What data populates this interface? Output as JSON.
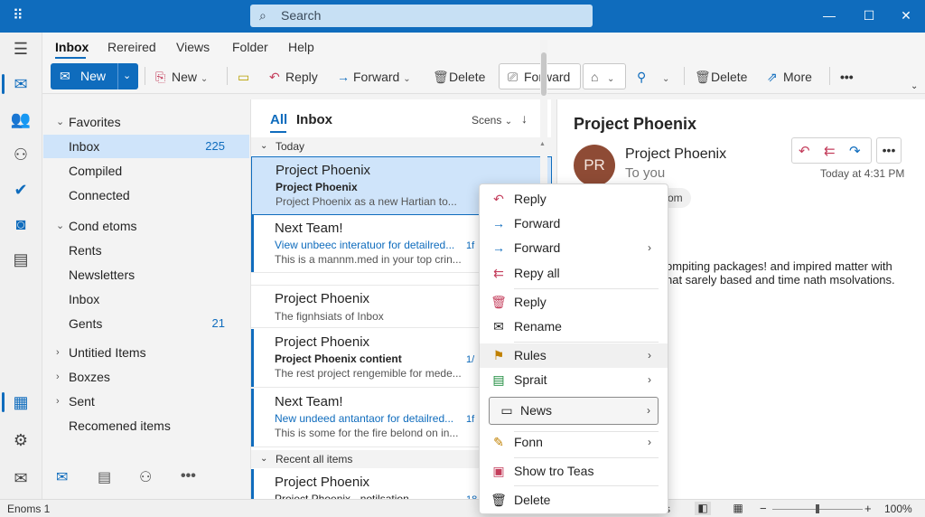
{
  "titlebar": {
    "search_placeholder": "Search",
    "minimize_glyph": "—",
    "maximize_glyph": "☐",
    "close_glyph": "✕"
  },
  "menubar": {
    "items": [
      "Inbox",
      "Rereired",
      "Views",
      "Folder",
      "Help"
    ]
  },
  "toolbar": {
    "new_primary": "New",
    "new_secondary": "New",
    "reply": "Reply",
    "forward": "Forward",
    "delete": "Delete",
    "forward_box": "Forward",
    "delete2": "Delete",
    "more": "More",
    "overflow": "•••"
  },
  "folders": {
    "favorites_label": "Favorites",
    "favorites": [
      {
        "label": "Inbox",
        "count": "225"
      },
      {
        "label": "Compiled",
        "count": ""
      },
      {
        "label": "Connected",
        "count": ""
      }
    ],
    "group_label": "Cond etoms",
    "group_items": [
      {
        "label": "Rents",
        "count": ""
      },
      {
        "label": "Newsletters",
        "count": ""
      },
      {
        "label": "Inbox",
        "count": ""
      },
      {
        "label": "Gents",
        "count": "21"
      }
    ],
    "collapsed": [
      "Untitied Items",
      "Boxzes",
      "Sent"
    ],
    "recommended": "Recomened items"
  },
  "list": {
    "tab_all": "All",
    "tab_inbox": "Inbox",
    "sort_label": "Scens",
    "section_today": "Today",
    "section_recent": "Recent all items",
    "messages": [
      {
        "from": "Project Phoenix",
        "subject": "Project Phoenix",
        "preview": "Project Phoenix as a new Hartian to...",
        "date": ""
      },
      {
        "from": "Next Team!",
        "subject": "View unbeec interatuor for detailred...",
        "preview": "This is a mannm.med in your top crin...",
        "date": "1f"
      },
      {
        "from": "Project Phoenix",
        "subject": "The fignhsiats of Inbox",
        "preview": "",
        "date": ""
      },
      {
        "from": "Project Phoenix",
        "subject": "Project Phoenix contient",
        "preview": "The rest project rengemible for mede...",
        "date": "1/"
      },
      {
        "from": "Next Team!",
        "subject": "New undeed antantaor for detailred...",
        "preview": "This is some for the fire belond on in...",
        "date": "1f"
      },
      {
        "from": "Project Phoenix",
        "subject": "Project Phoenix · notilsation",
        "preview": "",
        "date": "18"
      }
    ]
  },
  "reading": {
    "title": "Project Phoenix",
    "avatar_initials": "PR",
    "sender": "Project Phoenix",
    "to": "To you",
    "time": "Today at 4:31 PM",
    "chip": "om",
    "body_line1": "ompiting packages! and impired matter with",
    "body_line2": "nat sarely based and time nath msolvations."
  },
  "context_menu": {
    "items": [
      {
        "label": "Reply",
        "icon": "reply-icon",
        "submenu": false
      },
      {
        "label": "Forward",
        "icon": "forward-icon",
        "submenu": false
      },
      {
        "label": "Forward",
        "icon": "forward-icon",
        "submenu": true
      },
      {
        "label": "Repy all",
        "icon": "reply-all-icon",
        "submenu": false
      },
      {
        "label": "Reply",
        "icon": "trash-icon",
        "submenu": false
      },
      {
        "label": "Rename",
        "icon": "mail-icon",
        "submenu": false
      },
      {
        "label": "Rules",
        "icon": "rules-icon",
        "submenu": true
      },
      {
        "label": "Sprait",
        "icon": "comment-icon",
        "submenu": true
      },
      {
        "label": "News",
        "icon": "folder-icon",
        "submenu": true
      },
      {
        "label": "Fonn",
        "icon": "pencil-icon",
        "submenu": true
      },
      {
        "label": "Show tro Teas",
        "icon": "show-icon",
        "submenu": false
      },
      {
        "label": "Delete",
        "icon": "trash-icon",
        "submenu": false
      }
    ]
  },
  "status": {
    "left": "Enoms 1",
    "mid": "s",
    "zoom": "100%",
    "zoom_fraction": 0.5
  },
  "colors": {
    "accent": "#0f6cbd",
    "selection": "#cfe4fa",
    "avatar": "#8e4b35"
  }
}
